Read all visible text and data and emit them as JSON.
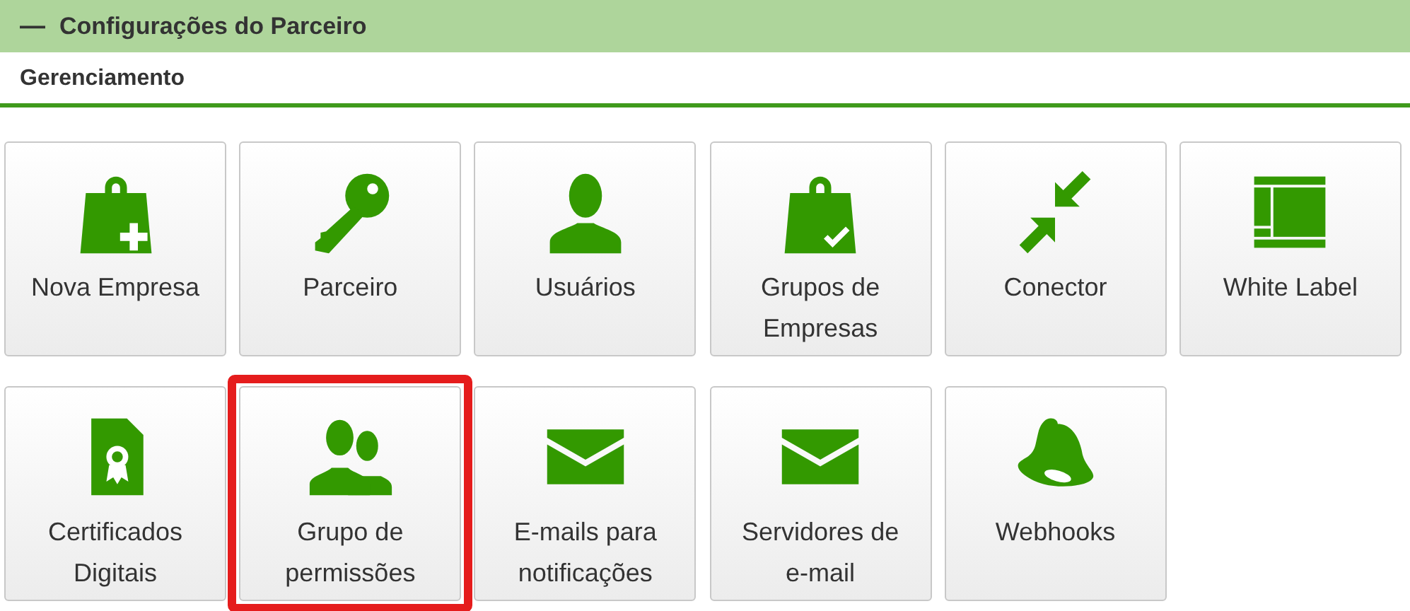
{
  "panel": {
    "title": "Configurações do Parceiro",
    "collapse_glyph": "—",
    "section": "Gerenciamento"
  },
  "tiles": [
    {
      "label": "Nova Empresa",
      "highlighted": false
    },
    {
      "label": "Parceiro",
      "highlighted": false
    },
    {
      "label": "Usuários",
      "highlighted": false
    },
    {
      "label": "Grupos de Empresas",
      "highlighted": false
    },
    {
      "label": "Conector",
      "highlighted": false
    },
    {
      "label": "White Label",
      "highlighted": false
    },
    {
      "label": "Certificados Digitais",
      "highlighted": false
    },
    {
      "label": "Grupo de permissões",
      "highlighted": true
    },
    {
      "label": "E-mails para notificações",
      "highlighted": false
    },
    {
      "label": "Servidores de e-mail",
      "highlighted": false
    },
    {
      "label": "Webhooks",
      "highlighted": false
    }
  ]
}
